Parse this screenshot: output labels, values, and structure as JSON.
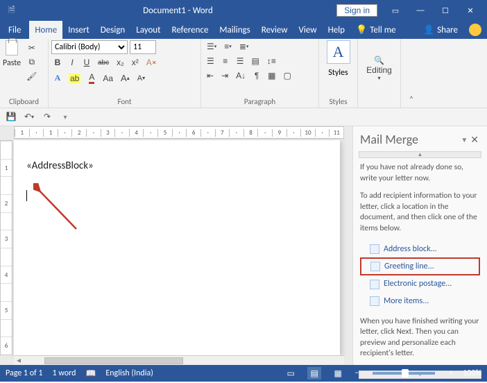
{
  "titlebar": {
    "title": "Document1 - Word",
    "signin": "Sign in"
  },
  "tabs": {
    "file": "File",
    "home": "Home",
    "insert": "Insert",
    "design": "Design",
    "layout": "Layout",
    "references": "Reference",
    "mailings": "Mailings",
    "review": "Review",
    "view": "View",
    "help": "Help",
    "tellme": "Tell me",
    "share": "Share"
  },
  "ribbon": {
    "clipboard": {
      "paste": "Paste",
      "label": "Clipboard"
    },
    "font": {
      "name": "Calibri (Body)",
      "size": "11",
      "label": "Font",
      "bold": "B",
      "italic": "I",
      "underline": "U",
      "strike": "abc",
      "sub": "x₂",
      "sup": "x²",
      "textfx": "A",
      "highlight": "ab",
      "color": "A",
      "case": "Aa",
      "grow": "A",
      "shrink": "A",
      "clearfmt": "✕"
    },
    "paragraph": {
      "label": "Paragraph"
    },
    "styles": {
      "label": "Styles"
    },
    "editing": {
      "label": "Editing"
    }
  },
  "document": {
    "merge_field": "«AddressBlock»"
  },
  "ruler": {
    "h": [
      "1",
      "·",
      "·",
      "1",
      "·",
      "2",
      "·",
      "3",
      "·",
      "4",
      "·",
      "5",
      "·",
      "6",
      "·",
      "7",
      "·",
      "8",
      "·",
      "9",
      "·",
      "10",
      "·",
      "11"
    ],
    "v": [
      "",
      "1",
      "",
      "2",
      "",
      "3",
      "",
      "4",
      "",
      "5",
      "",
      "6"
    ]
  },
  "taskpane": {
    "title": "Mail Merge",
    "intro1": "If you have not already done so, write your letter now.",
    "intro2": "To add recipient information to your letter, click a location in the document, and then click one of the items below.",
    "link_address": "Address block...",
    "link_greeting": "Greeting line...",
    "link_postage": "Electronic postage...",
    "link_more": "More items...",
    "outro": "When you have finished writing your letter, click Next. Then you can preview and personalize each recipient's letter."
  },
  "status": {
    "page": "Page 1 of 1",
    "words": "1 word",
    "lang": "English (India)",
    "zoom": "100%"
  }
}
